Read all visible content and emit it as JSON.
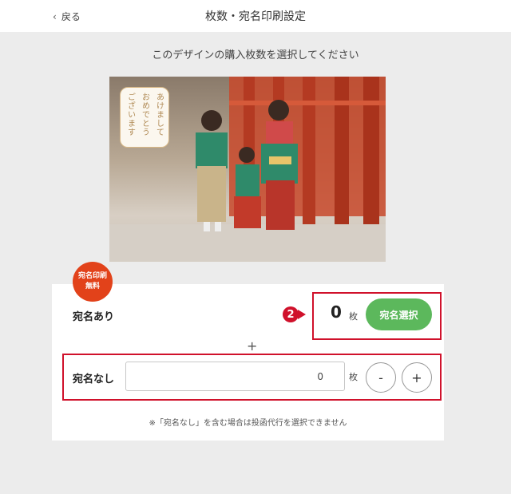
{
  "header": {
    "back_label": "戻る",
    "title": "枚数・宛名印刷設定"
  },
  "instruction": "このデザインの購入枚数を選択してください",
  "design": {
    "card_lines": [
      "あけまして",
      "おめでとう",
      "ございます"
    ]
  },
  "badge": {
    "line1": "宛名印刷",
    "line2": "無料"
  },
  "with_address": {
    "label": "宛名あり",
    "count": "0",
    "unit": "枚",
    "button_label": "宛名選択",
    "step_number": "2"
  },
  "separator": "+",
  "without_address": {
    "label": "宛名なし",
    "quantity": "0",
    "unit": "枚",
    "minus_label": "-",
    "plus_label": "+"
  },
  "note": "※「宛名なし」を含む場合は投函代行を選択できません",
  "colors": {
    "accent_red": "#d0112b",
    "badge_red": "#e2421a",
    "button_green": "#5cb85c"
  }
}
